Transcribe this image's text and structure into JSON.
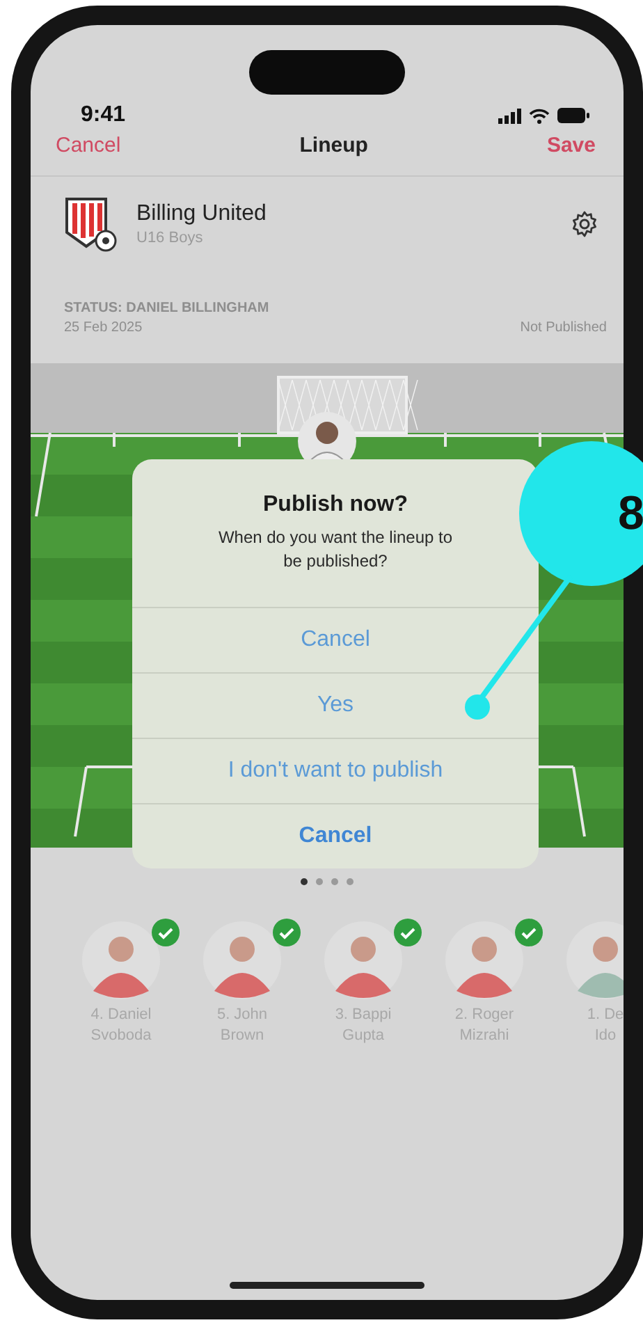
{
  "status_bar": {
    "time": "9:41"
  },
  "nav": {
    "cancel": "Cancel",
    "title": "Lineup",
    "save": "Save"
  },
  "team": {
    "name": "Billing United",
    "subtitle": "U16 Boys"
  },
  "status": {
    "label": "STATUS: DANIEL BILLINGHAM",
    "date": "25 Feb 2025",
    "state": "Not Published"
  },
  "dialog": {
    "title": "Publish now?",
    "message": "When do you want the lineup to be published?",
    "actions": [
      {
        "label": "Cancel",
        "emphasized": false
      },
      {
        "label": "Yes",
        "emphasized": false
      },
      {
        "label": "I don't want to publish",
        "emphasized": false
      },
      {
        "label": "Cancel",
        "emphasized": true
      }
    ]
  },
  "callout": {
    "number": "8"
  },
  "pager": [
    {
      "selected": true
    },
    {
      "selected": false
    },
    {
      "selected": false
    },
    {
      "selected": false
    }
  ],
  "players": [
    {
      "number": "4.",
      "first": "Daniel",
      "last": "Svoboda",
      "checked": true
    },
    {
      "number": "5.",
      "first": "John",
      "last": "Brown",
      "checked": true
    },
    {
      "number": "3.",
      "first": "Bappi",
      "last": "Gupta",
      "checked": true
    },
    {
      "number": "2.",
      "first": "Roger",
      "last": "Mizrahi",
      "checked": true
    },
    {
      "number": "1.",
      "first": "De",
      "last": "Ido",
      "checked": false
    }
  ]
}
